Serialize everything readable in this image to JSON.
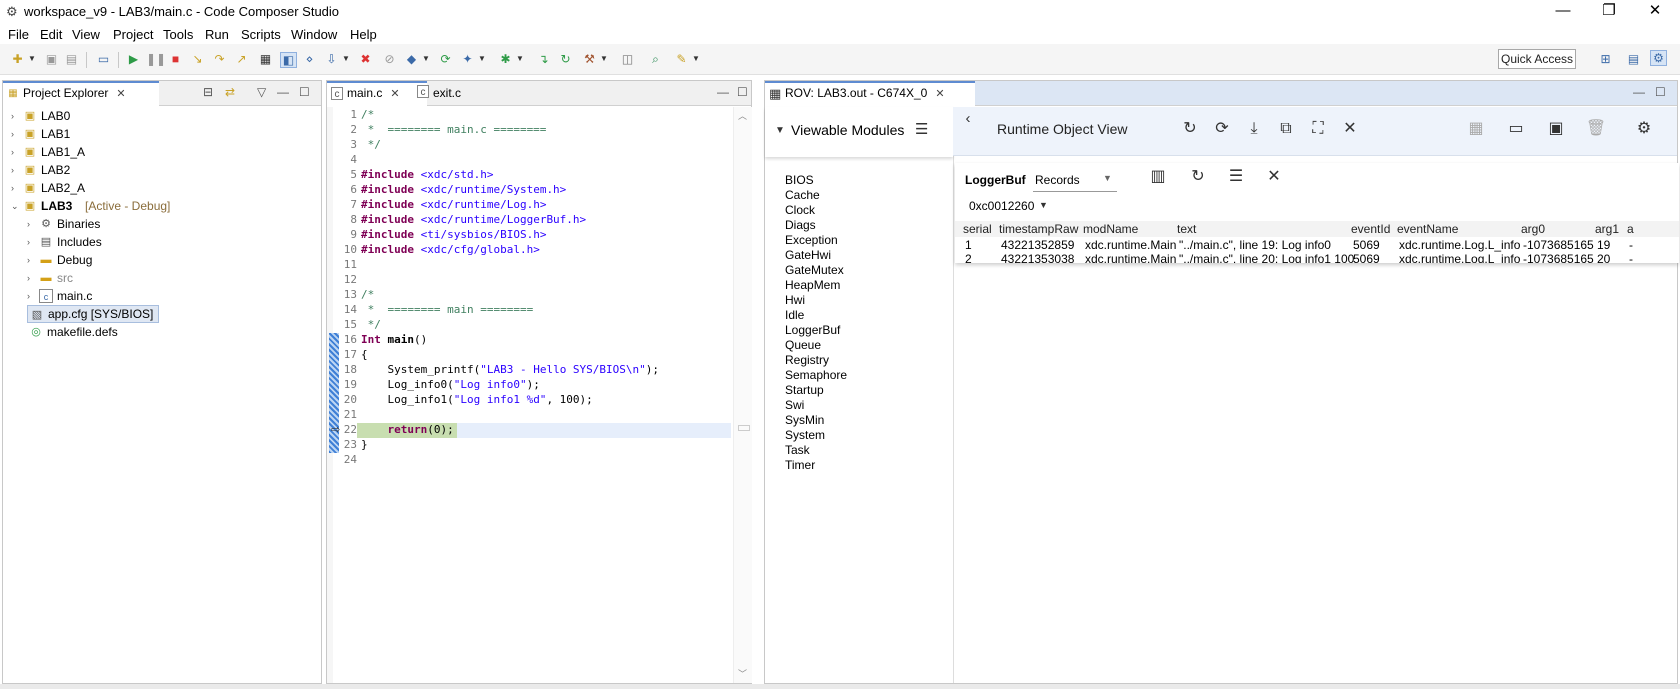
{
  "window": {
    "title": "workspace_v9 - LAB3/main.c - Code Composer Studio",
    "controls": {
      "minimize": "—",
      "restore": "❐",
      "close": "✕"
    }
  },
  "menu": [
    "File",
    "Edit",
    "View",
    "Project",
    "Tools",
    "Run",
    "Scripts",
    "Window",
    "Help"
  ],
  "toolbar": {
    "quick_access": "Quick Access"
  },
  "project_explorer": {
    "tab_label": "Project Explorer",
    "items": [
      {
        "label": "LAB0",
        "state": ""
      },
      {
        "label": "LAB1",
        "state": ""
      },
      {
        "label": "LAB1_A",
        "state": ""
      },
      {
        "label": "LAB2",
        "state": ""
      },
      {
        "label": "LAB2_A",
        "state": ""
      },
      {
        "label": "LAB3",
        "state": "[Active - Debug]"
      }
    ],
    "children": [
      {
        "label": "Binaries",
        "icon": "binaries-icon"
      },
      {
        "label": "Includes",
        "icon": "includes-icon"
      },
      {
        "label": "Debug",
        "icon": "folder-icon"
      },
      {
        "label": "src",
        "icon": "folder-icon"
      },
      {
        "label": "main.c",
        "icon": "c-file-icon"
      },
      {
        "label": "app.cfg [SYS/BIOS]",
        "icon": "cfg-file-icon"
      },
      {
        "label": "makefile.defs",
        "icon": "makefile-icon"
      }
    ]
  },
  "editor": {
    "tabs": [
      {
        "label": "main.c"
      },
      {
        "label": "exit.c"
      }
    ],
    "lines": [
      "/*",
      " *  ======== main.c ========",
      " */",
      "",
      "#include <xdc/std.h>",
      "#include <xdc/runtime/System.h>",
      "#include <xdc/runtime/Log.h>",
      "#include <xdc/runtime/LoggerBuf.h>",
      "#include <ti/sysbios/BIOS.h>",
      "#include <xdc/cfg/global.h>",
      "",
      "",
      "/*",
      " *  ======== main ========",
      " */",
      "Int main()",
      "{",
      "    System_printf(\"LAB3 - Hello SYS/BIOS\\n\");",
      "    Log_info0(\"Log info0\");",
      "    Log_info1(\"Log info1 %d\", 100);",
      "",
      "    return(0);",
      "}",
      ""
    ]
  },
  "rov": {
    "tab_label": "ROV: LAB3.out - C674X_0",
    "viewable_modules_label": "Viewable Modules",
    "runtime_title": "Runtime Object View",
    "modules": [
      "BIOS",
      "Cache",
      "Clock",
      "Diags",
      "Exception",
      "GateHwi",
      "GateMutex",
      "HeapMem",
      "Hwi",
      "Idle",
      "LoggerBuf",
      "Queue",
      "Registry",
      "Semaphore",
      "Startup",
      "Swi",
      "SysMin",
      "System",
      "Task",
      "Timer"
    ],
    "view": {
      "module": "LoggerBuf",
      "view_select": "Records",
      "address": "0xc0012260",
      "columns": [
        "serial",
        "timestampRaw",
        "modName",
        "text",
        "eventId",
        "eventName",
        "arg0",
        "arg1",
        "a"
      ],
      "rows": [
        [
          "1",
          "43221352859",
          "xdc.runtime.Main",
          "\"../main.c\", line 19: Log info0",
          "5069",
          "xdc.runtime.Log.L_info",
          "-1073685165",
          "19",
          "-"
        ],
        [
          "2",
          "43221353038",
          "xdc.runtime.Main",
          "\"../main.c\", line 20: Log info1 100",
          "5069",
          "xdc.runtime.Log.L_info",
          "-1073685165",
          "20",
          "-"
        ]
      ]
    }
  },
  "colors": {
    "accent": "#5e8bd1",
    "rov_header": "#eef3fb",
    "keyword": "#7f0055",
    "string": "#2a00ff",
    "comment": "#3f7f5f"
  }
}
